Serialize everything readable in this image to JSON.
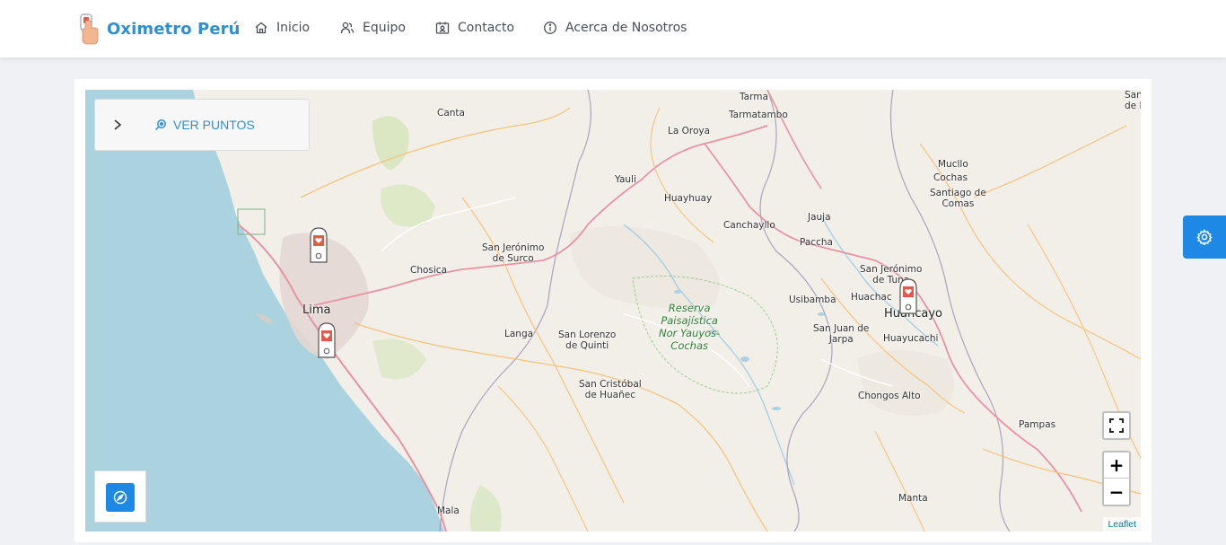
{
  "brand": {
    "name": "Oximetro Perú",
    "logo_icon": "finger-oximeter-icon"
  },
  "nav": {
    "inicio": "Inicio",
    "equipo": "Equipo",
    "contacto": "Contacto",
    "acerca": "Acerca de Nosotros"
  },
  "panel": {
    "button_label": "VER PUNTOS"
  },
  "map": {
    "attribution": "Leaflet",
    "zoom_in": "+",
    "zoom_out": "−",
    "labels": {
      "tarma": "Tarma",
      "tarmatambo": "Tarmatambo",
      "canta": "Canta",
      "la_oroya": "La Oroya",
      "yauli": "Yauli",
      "huayhuay": "Huayhuay",
      "canchayllo": "Canchayllo",
      "jauja": "Jauja",
      "paccha": "Paccha",
      "mucllo": "Mucllo",
      "cochas": "Cochas",
      "santiago_1": "Santiago de",
      "santiago_2": "Comas",
      "san_jeronimo_surco_1": "San Jerónimo",
      "san_jeronimo_surco_2": "de Surco",
      "chosica": "Chosica",
      "lima": "Lima",
      "langa": "Langa",
      "san_lorenzo_1": "San Lorenzo",
      "san_lorenzo_2": "de Quinti",
      "reserva_1": "Reserva",
      "reserva_2": "Paisajística",
      "reserva_3": "Nor Yauyos-",
      "reserva_4": "Cochas",
      "san_cristobal_1": "San Cristóbal",
      "san_cristobal_2": "de Huañec",
      "usibamba": "Usibamba",
      "huachac": "Huachac",
      "san_jeronimo_tuna_1": "San Jerónimo",
      "san_jeronimo_tuna_2": "de Tuna",
      "huancayo": "Huancayo",
      "san_juan_1": "San Juan de",
      "san_juan_2": "Jarpa",
      "huayucachi": "Huayucachi",
      "chongos": "Chongos Alto",
      "pampas": "Pampas",
      "manta": "Manta",
      "mala": "Mala",
      "san_edge_1": "San",
      "san_edge_2": "de L"
    },
    "markers_icon": "oximeter-marker-icon"
  },
  "colors": {
    "accent": "#2f8fd3",
    "button_blue": "#1e88e5",
    "sea": "#aad3df",
    "land": "#f2efe9",
    "marker_red": "#e05a47"
  }
}
